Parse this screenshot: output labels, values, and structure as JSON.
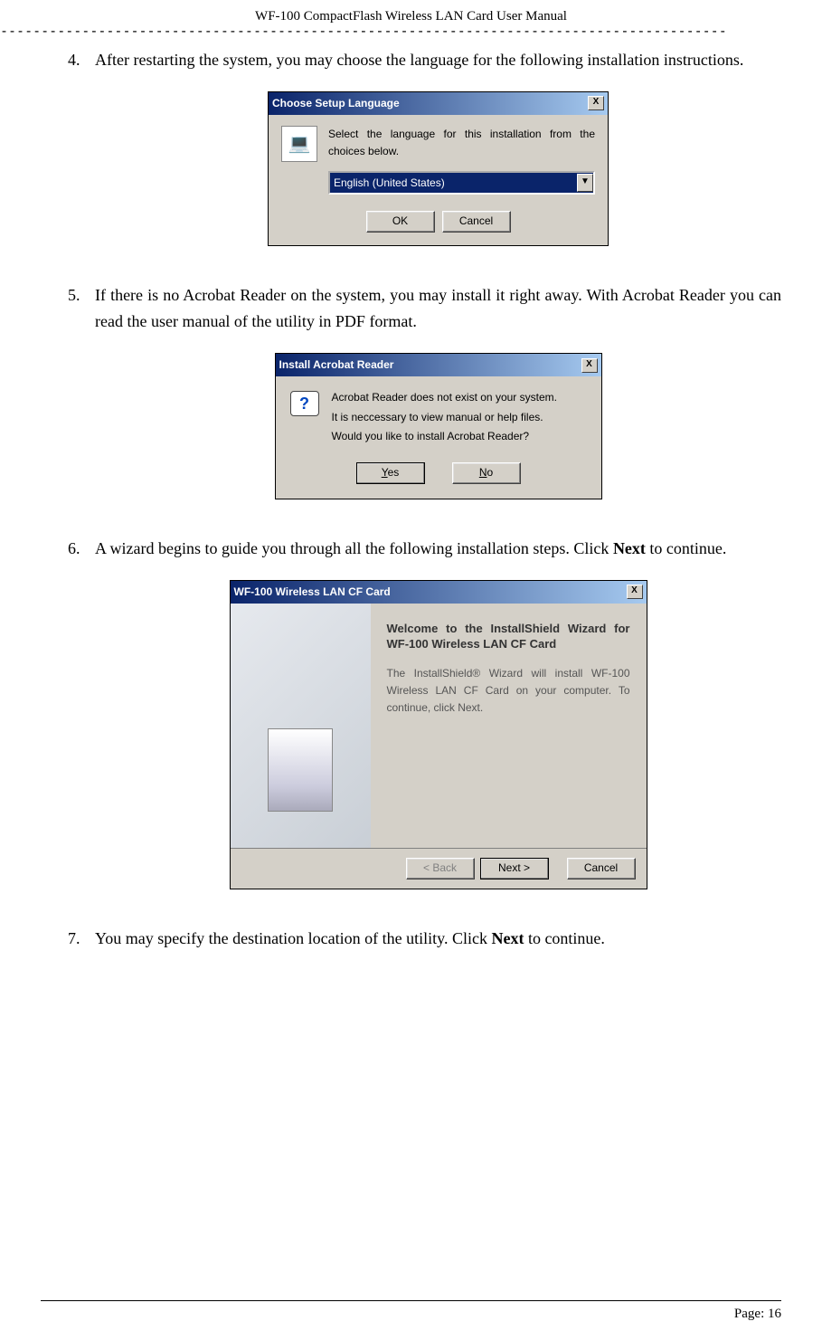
{
  "header": {
    "doc_title": "WF-100 CompactFlash Wireless LAN Card User Manual"
  },
  "steps": {
    "step4": {
      "text": "After restarting the system, you may choose the language for the following installation instructions."
    },
    "step5": {
      "text": "If there is no Acrobat Reader on the system, you may install it right away. With Acrobat Reader you can read the user manual of the utility in PDF format."
    },
    "step6": {
      "text_a": "A wizard begins to guide you through all the following installation steps. Click ",
      "bold": "Next",
      "text_b": " to continue."
    },
    "step7": {
      "text_a": "You may specify the destination location of the utility. Click ",
      "bold": "Next",
      "text_b": " to continue."
    }
  },
  "dlg1": {
    "title": "Choose Setup Language",
    "close": "X",
    "prompt": "Select the language for this installation from the choices below.",
    "combo_value": "English (United States)",
    "ok": "OK",
    "cancel": "Cancel"
  },
  "dlg2": {
    "title": "Install Acrobat Reader",
    "close": "X",
    "line1": "Acrobat Reader does not exist on your system.",
    "line2": "It is neccessary to view manual or help files.",
    "line3": "Would you like to install Acrobat Reader?",
    "yes_u": "Y",
    "yes_rest": "es",
    "no_u": "N",
    "no_rest": "o",
    "q": "?"
  },
  "dlg3": {
    "title": "WF-100 Wireless LAN CF Card",
    "close": "X",
    "wiz_title": "Welcome to the InstallShield Wizard for WF-100 Wireless LAN CF Card",
    "wiz_body": "The InstallShield® Wizard will install WF-100 Wireless LAN CF Card on your computer. To continue, click Next.",
    "back": "< Back",
    "next": "Next >",
    "cancel": "Cancel"
  },
  "footer": {
    "page": "Page: 16"
  }
}
